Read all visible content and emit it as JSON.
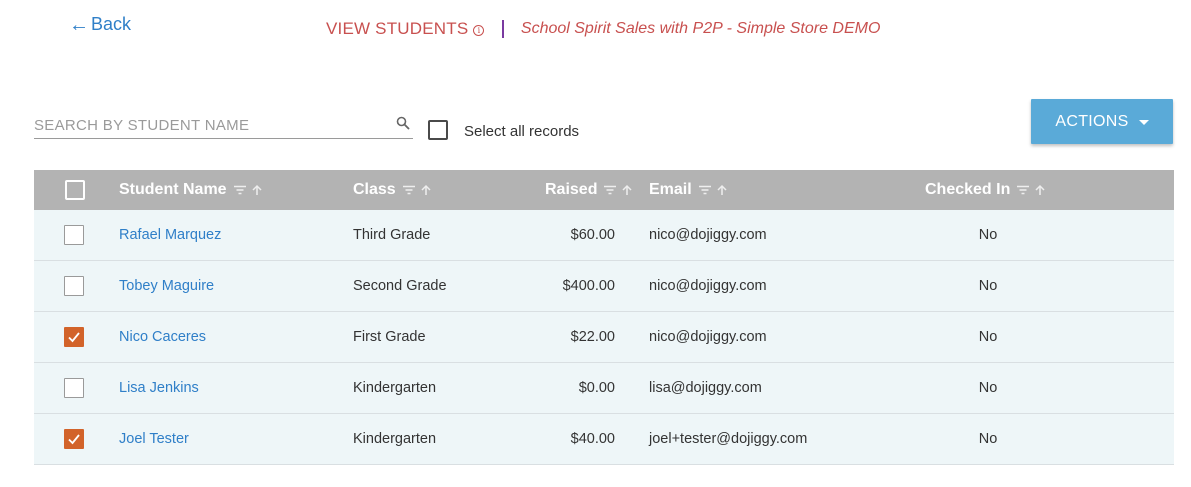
{
  "header": {
    "back_label": "Back",
    "title": "VIEW STUDENTS",
    "event_name": "School Spirit Sales with P2P - Simple Store DEMO"
  },
  "toolbar": {
    "search_placeholder": "SEARCH BY STUDENT NAME",
    "select_all_label": "Select all records",
    "actions_label": "ACTIONS"
  },
  "table": {
    "columns": {
      "name": "Student Name",
      "class": "Class",
      "raised": "Raised",
      "email": "Email",
      "checked_in": "Checked In"
    },
    "rows": [
      {
        "selected": false,
        "name": "Rafael Marquez",
        "class": "Third Grade",
        "raised": "$60.00",
        "email": "nico@dojiggy.com",
        "checked_in": "No"
      },
      {
        "selected": false,
        "name": "Tobey Maguire",
        "class": "Second Grade",
        "raised": "$400.00",
        "email": "nico@dojiggy.com",
        "checked_in": "No"
      },
      {
        "selected": true,
        "name": "Nico Caceres",
        "class": "First Grade",
        "raised": "$22.00",
        "email": "nico@dojiggy.com",
        "checked_in": "No"
      },
      {
        "selected": false,
        "name": "Lisa Jenkins",
        "class": "Kindergarten",
        "raised": "$0.00",
        "email": "lisa@dojiggy.com",
        "checked_in": "No"
      },
      {
        "selected": true,
        "name": "Joel Tester",
        "class": "Kindergarten",
        "raised": "$40.00",
        "email": "joel+tester@dojiggy.com",
        "checked_in": "No"
      }
    ]
  },
  "colors": {
    "accent_red": "#c8504f",
    "link_blue": "#2f7fc8",
    "actions_button": "#5aaad8",
    "checkbox_checked": "#d2632a",
    "header_gray": "#b3b3b3",
    "row_bg": "#eef6f8"
  },
  "icons": {
    "back": "arrow-left-icon",
    "info": "info-icon",
    "search": "search-icon",
    "sort": "filter-lines-icon",
    "sort_direction": "arrow-up-icon",
    "check": "check-icon",
    "dropdown": "caret-down-icon"
  }
}
